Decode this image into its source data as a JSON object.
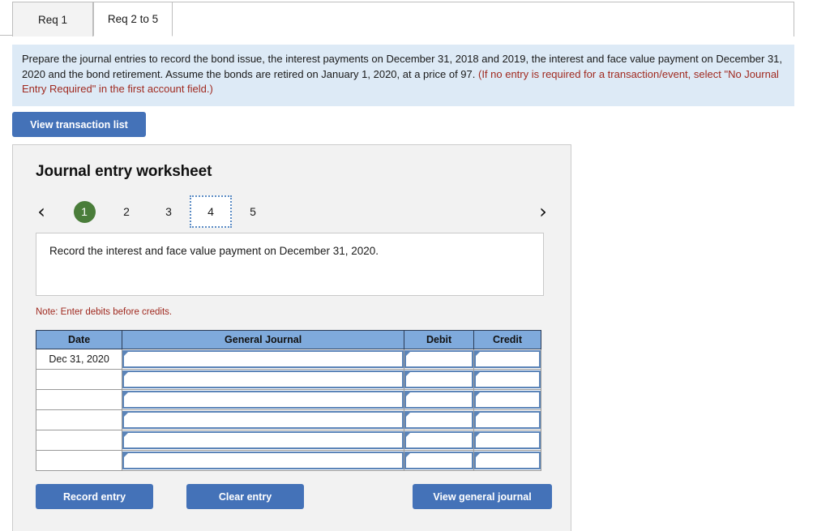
{
  "tabs": [
    {
      "label": "Req 1",
      "active": false
    },
    {
      "label": "Req 2 to 5",
      "active": true
    }
  ],
  "instructions": {
    "main": "Prepare the journal entries to record the bond issue, the interest payments on December 31, 2018 and 2019,  the interest and face value payment on December 31, 2020 and the bond retirement. Assume the bonds are retired on January 1, 2020, at a price of  97. ",
    "warning": "(If no entry is required for a transaction/event, select \"No Journal Entry Required\" in the first account field.)"
  },
  "transaction_button": "View transaction list",
  "worksheet": {
    "title": "Journal entry worksheet",
    "prev_icon": "chevron-left-icon",
    "next_icon": "chevron-right-icon",
    "steps": [
      {
        "label": "1",
        "state": "done"
      },
      {
        "label": "2",
        "state": "normal"
      },
      {
        "label": "3",
        "state": "normal"
      },
      {
        "label": "4",
        "state": "focused"
      },
      {
        "label": "5",
        "state": "normal"
      }
    ],
    "description": "Record the interest and face value payment on December 31, 2020.",
    "note": "Note: Enter debits before credits.",
    "table": {
      "headers": [
        "Date",
        "General Journal",
        "Debit",
        "Credit"
      ],
      "rows": [
        {
          "date": "Dec 31, 2020",
          "journal": "",
          "debit": "",
          "credit": ""
        },
        {
          "date": "",
          "journal": "",
          "debit": "",
          "credit": ""
        },
        {
          "date": "",
          "journal": "",
          "debit": "",
          "credit": ""
        },
        {
          "date": "",
          "journal": "",
          "debit": "",
          "credit": ""
        },
        {
          "date": "",
          "journal": "",
          "debit": "",
          "credit": ""
        },
        {
          "date": "",
          "journal": "",
          "debit": "",
          "credit": ""
        }
      ]
    },
    "actions": {
      "record": "Record entry",
      "clear": "Clear entry",
      "view_journal": "View general journal"
    }
  },
  "colors": {
    "button_blue": "#4472b8",
    "header_blue": "#7faadc",
    "panel_bg": "#f2f2f2",
    "instruction_bg": "#ddeaf6",
    "warning_red": "#a02a20",
    "step_green": "#4a7d3a",
    "field_border_blue": "#5b84b8"
  }
}
